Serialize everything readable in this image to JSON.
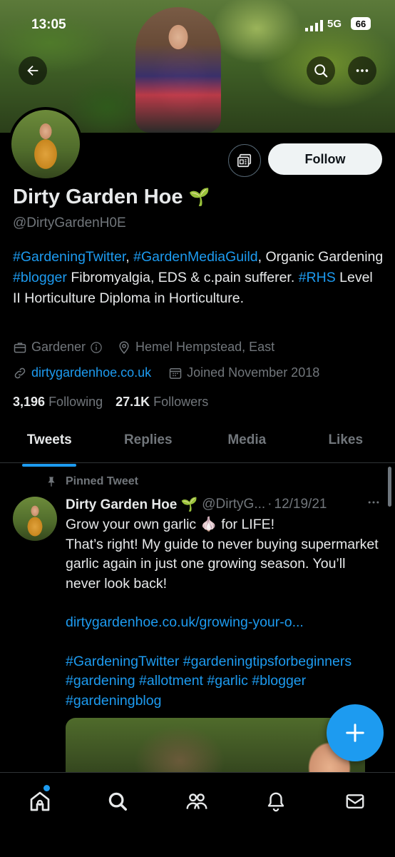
{
  "status_bar": {
    "time": "13:05",
    "network": "5G",
    "battery": "66"
  },
  "profile": {
    "display_name": "Dirty Garden Hoe",
    "name_emoji": "🌱",
    "handle": "@DirtyGardenH0E",
    "follow_label": "Follow",
    "bio_parts": [
      {
        "text": "#GardeningTwitter",
        "link": true
      },
      {
        "text": ", ",
        "link": false
      },
      {
        "text": "#GardenMediaGuild",
        "link": true
      },
      {
        "text": ", Organic Gardening ",
        "link": false
      },
      {
        "text": "#blogger",
        "link": true
      },
      {
        "text": " Fibromyalgia, EDS & c.pain sufferer. ",
        "link": false
      },
      {
        "text": "#RHS",
        "link": true
      },
      {
        "text": " Level II Horticulture Diploma in Horticulture.",
        "link": false
      }
    ],
    "category": "Gardener",
    "location": "Hemel Hempstead, East",
    "website": "dirtygardenhoe.co.uk",
    "joined": "Joined November 2018",
    "following_count": "3,196",
    "following_label": "Following",
    "followers_count": "27.1K",
    "followers_label": "Followers"
  },
  "tabs": [
    "Tweets",
    "Replies",
    "Media",
    "Likes"
  ],
  "active_tab": "Tweets",
  "tweet": {
    "pinned_label": "Pinned Tweet",
    "author_name": "Dirty Garden Hoe",
    "author_emoji": "🌱",
    "author_handle": "@DirtyG...",
    "separator": "·",
    "date": "12/19/21",
    "line1_text": "Grow your own garlic ",
    "line1_emoji": "🧄",
    "line1_end": " for LIFE!",
    "paragraph": "That’s right! My guide to never buying supermarket garlic again in just one growing season. You’ll never look back!",
    "link": "dirtygardenhoe.co.uk/growing-your-o...",
    "hashtags": "#GardeningTwitter #gardeningtipsforbeginners #gardening #allotment #garlic #blogger #gardeningblog"
  },
  "colors": {
    "accent": "#1d9bf0",
    "background": "#000000",
    "text": "#e7e9ea",
    "muted": "#71767b"
  },
  "icons": [
    "back-arrow-icon",
    "search-icon",
    "more-icon",
    "newsletter-icon",
    "briefcase-icon",
    "info-icon",
    "location-pin-icon",
    "link-icon",
    "calendar-icon",
    "pin-icon",
    "compose-plus-icon",
    "home-icon",
    "explore-icon",
    "communities-icon",
    "notifications-icon",
    "messages-icon"
  ]
}
